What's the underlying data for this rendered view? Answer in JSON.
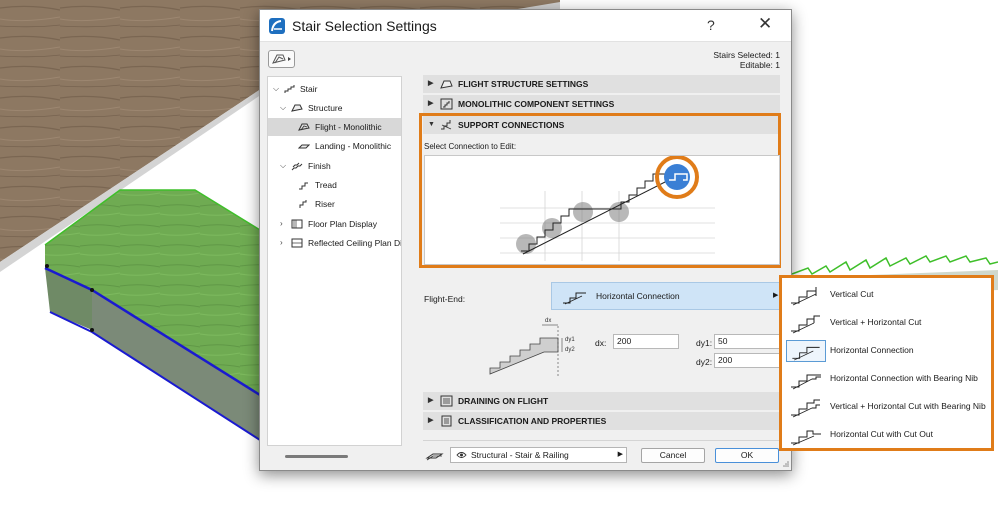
{
  "dialog": {
    "title": "Stair Selection Settings",
    "help_label": "?",
    "close_label": "✕",
    "stairs_selected": "Stairs Selected: 1",
    "editable": "Editable: 1"
  },
  "tree": {
    "items": [
      {
        "label": "Stair",
        "icon": "stair-icon",
        "expanded": true
      },
      {
        "label": "Structure",
        "icon": "structure-icon",
        "expanded": true
      },
      {
        "label": "Flight - Monolithic",
        "icon": "flight-icon",
        "selected": true
      },
      {
        "label": "Landing - Monolithic",
        "icon": "landing-icon"
      },
      {
        "label": "Finish",
        "icon": "finish-icon",
        "expanded": true
      },
      {
        "label": "Tread",
        "icon": "tread-icon"
      },
      {
        "label": "Riser",
        "icon": "riser-icon"
      },
      {
        "label": "Floor Plan Display",
        "icon": "floor-plan-icon",
        "expanded": false
      },
      {
        "label": "Reflected Ceiling Plan Di",
        "icon": "ceiling-plan-icon",
        "expanded": false
      }
    ]
  },
  "sections": {
    "flight_structure": "FLIGHT STRUCTURE SETTINGS",
    "monolithic": "MONOLITHIC COMPONENT SETTINGS",
    "support": "SUPPORT CONNECTIONS",
    "draining": "DRAINING ON FLIGHT",
    "classification": "CLASSIFICATION AND PROPERTIES"
  },
  "support": {
    "select_label": "Select Connection to Edit:",
    "flight_end_label": "Flight-End:",
    "flight_end_value": "Horizontal Connection",
    "dx_label": "dx:",
    "dx_value": "200",
    "dy1_label": "dy1:",
    "dy1_value": "50",
    "dy2_label": "dy2:",
    "dy2_value": "200",
    "diagram_labels": {
      "dx": "dx",
      "dy1": "dy1",
      "dy2": "dy2"
    }
  },
  "footer": {
    "layer_value": "Structural - Stair & Railing",
    "cancel_label": "Cancel",
    "ok_label": "OK"
  },
  "popup": {
    "items": [
      {
        "label": "Vertical Cut",
        "icon": "vertical-cut-icon"
      },
      {
        "label": "Vertical + Horizontal Cut",
        "icon": "vertical-horizontal-cut-icon"
      },
      {
        "label": "Horizontal Connection",
        "icon": "horizontal-connection-icon",
        "selected": true
      },
      {
        "label": "Horizontal Connection with Bearing Nib",
        "icon": "bearing-nib-icon"
      },
      {
        "label": "Vertical + Horizontal Cut with Bearing Nib",
        "icon": "vh-cut-bearing-nib-icon"
      },
      {
        "label": "Horizontal Cut with Cut Out",
        "icon": "cut-out-icon"
      }
    ]
  },
  "colors": {
    "highlight": "#e07c19",
    "selection_blue": "#cfe4f7",
    "stair_green": "#3fbf2a",
    "edge_blue": "#1a1ad0",
    "floor_wood": "#8a7560"
  }
}
